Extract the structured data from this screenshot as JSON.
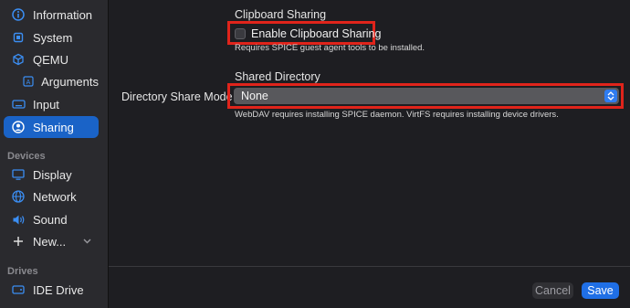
{
  "sidebar": {
    "items": [
      {
        "label": "Information",
        "icon": "info-circle-icon"
      },
      {
        "label": "System",
        "icon": "cpu-icon"
      },
      {
        "label": "QEMU",
        "icon": "cube-icon"
      },
      {
        "label": "Arguments",
        "icon": "text-box-icon"
      },
      {
        "label": "Input",
        "icon": "keyboard-icon"
      },
      {
        "label": "Sharing",
        "icon": "person-circle-icon",
        "selected": true
      }
    ],
    "devices_label": "Devices",
    "devices": [
      {
        "label": "Display",
        "icon": "monitor-icon"
      },
      {
        "label": "Network",
        "icon": "globe-icon"
      },
      {
        "label": "Sound",
        "icon": "speaker-icon"
      },
      {
        "label": "New...",
        "icon": "plus-icon"
      }
    ],
    "drives_label": "Drives",
    "drives": [
      {
        "label": "IDE Drive",
        "icon": "drive-icon"
      }
    ]
  },
  "clipboard": {
    "heading": "Clipboard Sharing",
    "checkbox_label": "Enable Clipboard Sharing",
    "checked": false,
    "caption": "Requires SPICE guest agent tools to be installed."
  },
  "shared_directory": {
    "heading": "Shared Directory",
    "mode_label": "Directory Share Mode",
    "mode_value": "None",
    "caption": "WebDAV requires installing SPICE daemon. VirtFS requires installing device drivers."
  },
  "buttons": {
    "cancel": "Cancel",
    "save": "Save"
  },
  "colors": {
    "accent": "#1a63c7",
    "highlight_box": "#e0241b"
  }
}
